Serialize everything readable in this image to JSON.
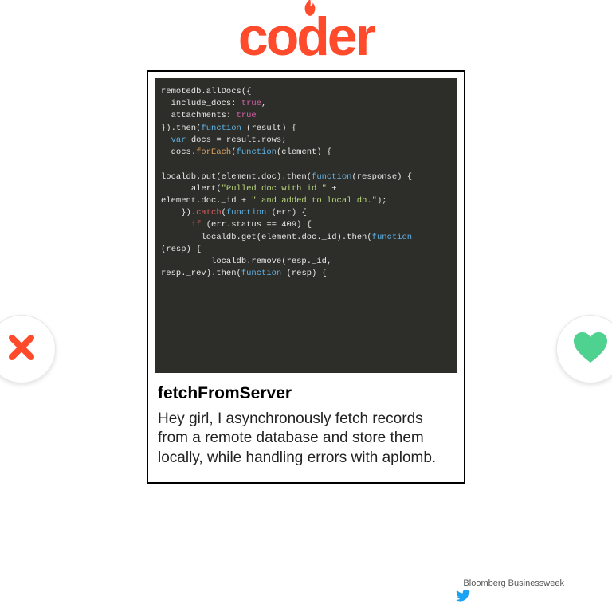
{
  "logo": {
    "text": "coder"
  },
  "profile": {
    "name": "fetchFromServer",
    "bio": "Hey girl, I asynchronously fetch records from a remote database and store them locally, while handling errors with aplomb."
  },
  "code": {
    "lines": [
      {
        "t": "remotedb.allDocs({"
      },
      {
        "t": "  include_docs: ",
        "b": "true",
        "t2": ","
      },
      {
        "t": "  attachments: ",
        "b": "true"
      },
      {
        "t": "}).then(",
        "k": "function",
        "t2": " (result) {"
      },
      {
        "pre": "  ",
        "k": "var",
        "t": " docs = result.rows;"
      },
      {
        "t": "  docs.",
        "f": "forEach",
        "t2": "(",
        "k": "function",
        "t3": "(element) {"
      },
      {
        "t": ""
      },
      {
        "t": "localdb.put(element.doc).then(",
        "k": "function",
        "t2": "(response) {"
      },
      {
        "t": "      alert(",
        "s": "\"Pulled doc with id \"",
        "t2": " +"
      },
      {
        "t": "element.doc._id + ",
        "s": "\" and added to local db.\"",
        "t2": ");"
      },
      {
        "t": "    }).",
        "e": "catch",
        "t2": "(",
        "k": "function",
        "t3": " (err) {"
      },
      {
        "t": "      ",
        "e": "if",
        "t2": " (err.status == 409) {"
      },
      {
        "t": "        localdb.get(element.doc._id).then(",
        "k": "function"
      },
      {
        "t": "(resp) {"
      },
      {
        "t": "          localdb.remove(resp._id,"
      },
      {
        "t": "resp._rev).then(",
        "k": "function",
        "t2": " (resp) {"
      }
    ]
  },
  "attribution": "Bloomberg Businessweek",
  "icons": {
    "reject": "x-icon",
    "like": "heart-icon",
    "flame": "flame-icon",
    "twitter": "twitter-icon"
  }
}
